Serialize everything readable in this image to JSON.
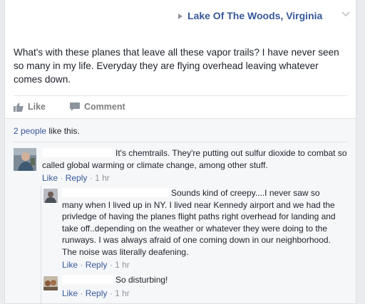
{
  "post": {
    "location": "Lake Of The Woods, Virginia",
    "text": "What's with these planes that leave all these vapor trails? I have never seen so many in my life. Everyday they are flying overhead leaving whatever comes down."
  },
  "actions": {
    "like": "Like",
    "comment": "Comment"
  },
  "likes": {
    "count": "2 people",
    "suffix": " like this."
  },
  "comments": [
    {
      "text": "It's chemtrails. They're putting out sulfur dioxide to combat so called global warming or climate change, among other stuff.",
      "like": "Like",
      "reply": "Reply",
      "time": "1 hr"
    },
    {
      "text": "Sounds kind of creepy....I never saw so many when I lived up in NY. I lived near Kennedy airport and we had the privledge of having the planes flight paths right overhead for landing and take off..depending on the weather or whatever they were doing to the runways. I was always afraid of one coming down in our neighborhood. The noise was literally deafening.",
      "like": "Like",
      "reply": "Reply",
      "time": "1 hr"
    },
    {
      "text": "So disturbing!",
      "like": "Like",
      "reply": "Reply",
      "time": "1 hr"
    }
  ]
}
